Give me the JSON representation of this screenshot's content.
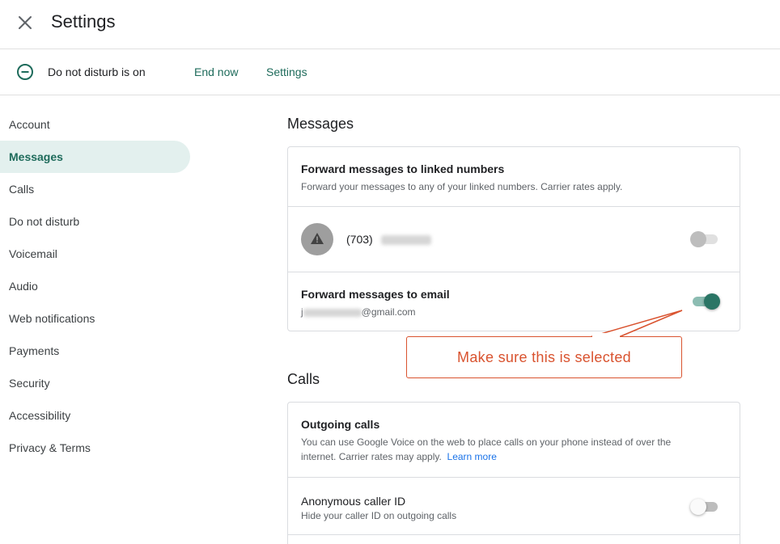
{
  "header": {
    "title": "Settings",
    "close_icon": "close-icon"
  },
  "dnd": {
    "icon": "minus-circle-icon",
    "status": "Do not disturb is on",
    "end_now": "End now",
    "settings": "Settings"
  },
  "sidebar": {
    "items": [
      {
        "label": "Account",
        "active": false
      },
      {
        "label": "Messages",
        "active": true
      },
      {
        "label": "Calls",
        "active": false
      },
      {
        "label": "Do not disturb",
        "active": false
      },
      {
        "label": "Voicemail",
        "active": false
      },
      {
        "label": "Audio",
        "active": false
      },
      {
        "label": "Web notifications",
        "active": false
      },
      {
        "label": "Payments",
        "active": false
      },
      {
        "label": "Security",
        "active": false
      },
      {
        "label": "Accessibility",
        "active": false
      },
      {
        "label": "Privacy & Terms",
        "active": false
      }
    ]
  },
  "messages": {
    "title": "Messages",
    "forward_linked": {
      "title": "Forward messages to linked numbers",
      "subtitle": "Forward your messages to any of your linked numbers. Carrier rates apply."
    },
    "linked_number": {
      "icon": "warning-icon",
      "area_code": "(703)",
      "toggle": "off-disabled"
    },
    "forward_email": {
      "title": "Forward messages to email",
      "email_start": "j",
      "email_end": "@gmail.com",
      "toggle": "on"
    }
  },
  "annotation": {
    "text": "Make sure this is selected",
    "color": "#d9532f"
  },
  "calls": {
    "title": "Calls",
    "outgoing": {
      "title": "Outgoing calls",
      "subtitle": "You can use Google Voice on the web to place calls on your phone instead of over the internet. Carrier rates may apply.",
      "learn_more": "Learn more"
    },
    "anonymous": {
      "title": "Anonymous caller ID",
      "subtitle": "Hide your caller ID on outgoing calls",
      "toggle": "off"
    }
  },
  "colors": {
    "accent": "#1e6b5b",
    "toggle_on": "#2a7565",
    "link": "#1a73e8"
  }
}
